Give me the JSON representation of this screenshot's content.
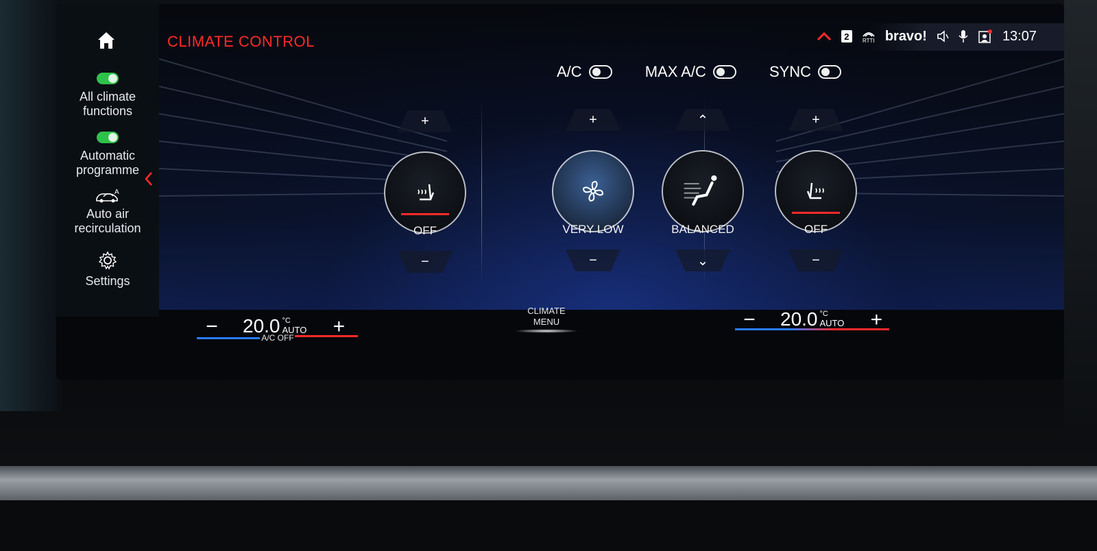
{
  "title": "CLIMATE CONTROL",
  "status": {
    "carrier": "bravo!",
    "badge": "2",
    "rtti": "RTTI",
    "time": "13:07"
  },
  "sidebar": {
    "items": [
      {
        "label_1": "All climate",
        "label_2": "functions",
        "on": true
      },
      {
        "label_1": "Automatic",
        "label_2": "programme",
        "on": true
      },
      {
        "label_1": "Auto air",
        "label_2": "recirculation"
      },
      {
        "label_1": "Settings"
      }
    ]
  },
  "toggles": {
    "ac": "A/C",
    "max_ac": "MAX A/C",
    "sync": "SYNC"
  },
  "controls": {
    "seat_left": {
      "label": "OFF",
      "up": "+",
      "down": "−"
    },
    "fan": {
      "label": "VERY LOW",
      "up": "+",
      "down": "−"
    },
    "airflow": {
      "label": "BALANCED",
      "up": "⌃",
      "down": "⌄"
    },
    "seat_right": {
      "label": "OFF",
      "up": "+",
      "down": "−"
    }
  },
  "bottom": {
    "left": {
      "minus": "−",
      "value": "20.0",
      "unit": "°C",
      "mode": "AUTO",
      "plus": "+",
      "ac_off": "A/C OFF"
    },
    "menu": {
      "line1": "CLIMATE",
      "line2": "MENU"
    },
    "right": {
      "minus": "−",
      "value": "20.0",
      "unit": "°C",
      "mode": "AUTO",
      "plus": "+"
    }
  },
  "colors": {
    "accent_red": "#ff2a2a",
    "toggle_green": "#2ec24a",
    "cool_blue": "#2a7bff"
  }
}
